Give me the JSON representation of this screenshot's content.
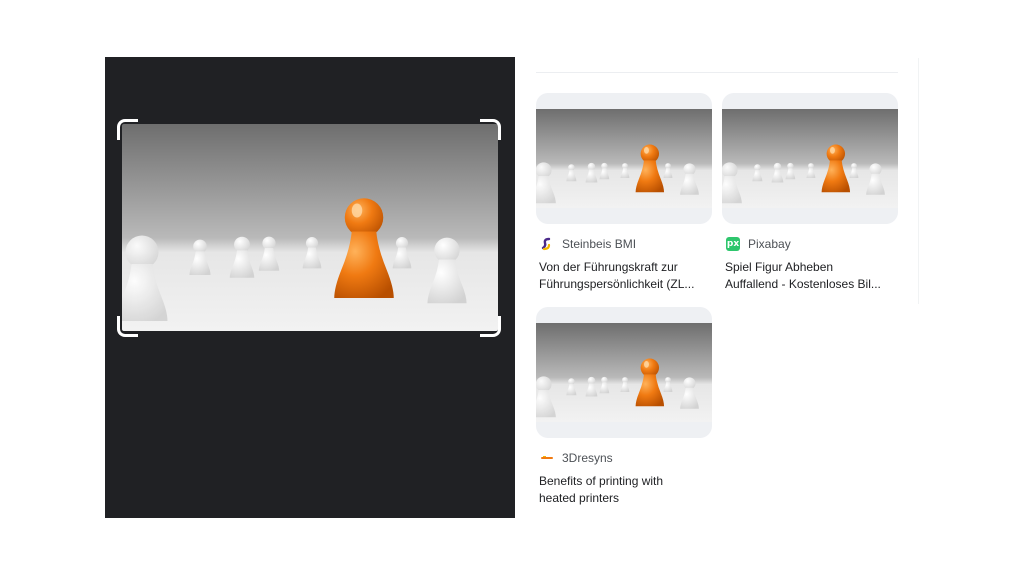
{
  "preview": {
    "image_alt": "Orange game piece among white pawns"
  },
  "results": [
    {
      "source": "Steinbeis BMI",
      "favicon": "steinbeis-logo-icon",
      "title_line1": "Von der Führungskraft zur",
      "title_line2": "Führungspersönlichkeit (ZL..."
    },
    {
      "source": "Pixabay",
      "favicon": "pixabay-logo-icon",
      "favicon_text": "px",
      "title_line1": "Spiel Figur Abheben",
      "title_line2": "Auffallend - Kostenloses Bil..."
    },
    {
      "source": "3Dresyns",
      "favicon": "3dresyns-logo-icon",
      "title_line1": "Benefits of printing with",
      "title_line2": "heated printers"
    }
  ],
  "colors": {
    "panel_bg": "#202124",
    "accent_orange": "#f07a12",
    "pixabay_green": "#2ec66d",
    "steinbeis_purple": "#4b2a8a",
    "steinbeis_yellow": "#f5b800"
  }
}
